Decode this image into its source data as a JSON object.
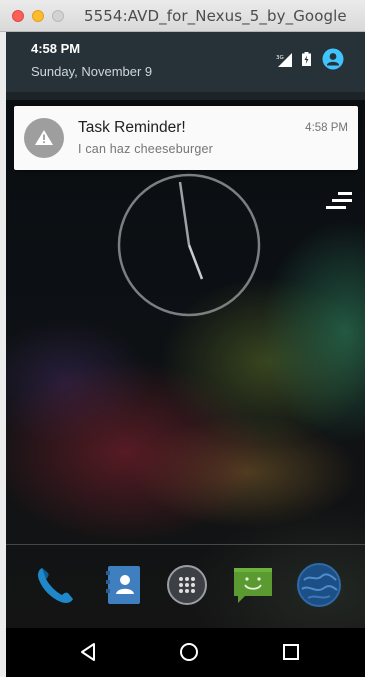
{
  "window": {
    "title": "5554:AVD_for_Nexus_5_by_Google"
  },
  "status_header": {
    "time": "4:58 PM",
    "date": "Sunday, November 9",
    "network_label": "3G"
  },
  "notification": {
    "title": "Task Reminder!",
    "text": "I can haz  cheeseburger",
    "time": "4:58 PM",
    "icon": "warning-icon"
  },
  "dock": {
    "apps": [
      "phone-icon",
      "contacts-icon",
      "app-drawer-icon",
      "messaging-icon",
      "browser-icon"
    ]
  },
  "navigation": {
    "buttons": [
      "back-icon",
      "home-icon",
      "recents-icon"
    ]
  },
  "colors": {
    "shade_header": "#263238",
    "notification_bg": "#fafafa",
    "accent": "#40c4ff"
  }
}
